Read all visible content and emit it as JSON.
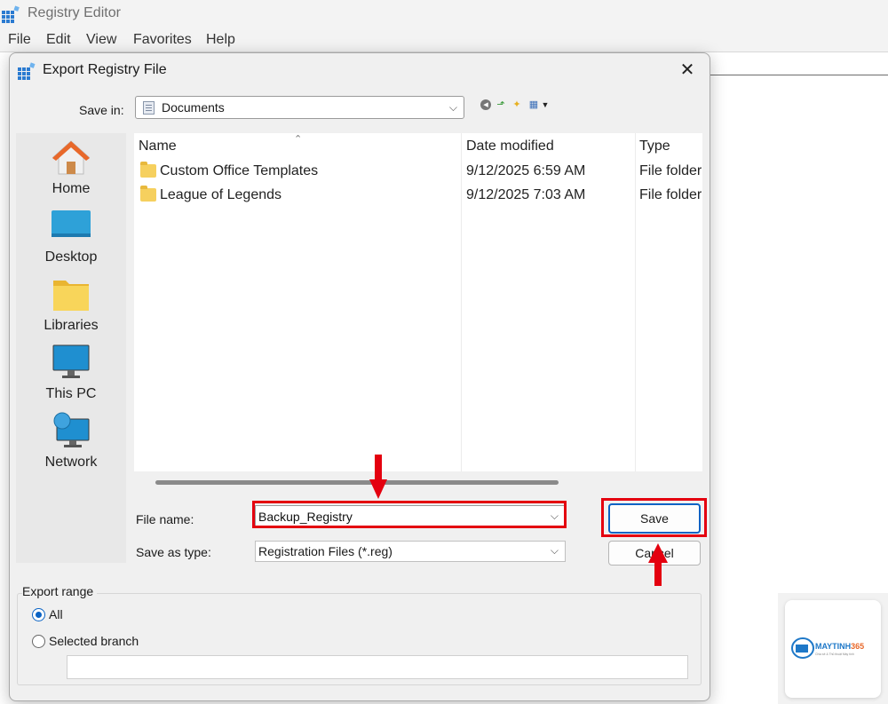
{
  "app": {
    "title": "Registry Editor",
    "menu": [
      "File",
      "Edit",
      "View",
      "Favorites",
      "Help"
    ]
  },
  "dialog": {
    "title": "Export Registry File",
    "close_label": "✕",
    "save_in_label": "Save in:",
    "save_in_value": "Documents",
    "places": [
      {
        "label": "Home",
        "icon": "home-icon"
      },
      {
        "label": "Desktop",
        "icon": "desktop-icon"
      },
      {
        "label": "Libraries",
        "icon": "libraries-icon"
      },
      {
        "label": "This PC",
        "icon": "this-pc-icon"
      },
      {
        "label": "Network",
        "icon": "network-icon"
      }
    ],
    "columns": [
      "Name",
      "Date modified",
      "Type"
    ],
    "files": [
      {
        "name": "Custom Office Templates",
        "date": "9/12/2025 6:59 AM",
        "type": "File folder"
      },
      {
        "name": "League of Legends",
        "date": "9/12/2025 7:03 AM",
        "type": "File folder"
      }
    ],
    "file_name_label": "File name:",
    "file_name_value": "Backup_Registry",
    "save_type_label": "Save as type:",
    "save_type_value": "Registration Files (*.reg)",
    "save_button": "Save",
    "cancel_button": "Cancel",
    "export_range": {
      "title": "Export range",
      "all_label": "All",
      "selected_label": "Selected branch",
      "branch_value": ""
    }
  },
  "watermark": {
    "brand": "MAYTINH365",
    "tagline": "Chia sẻ & Thủ thuật Máy tính"
  },
  "colors": {
    "highlight": "#e4000f",
    "accent": "#0b63c4",
    "folder": "#f6d05e"
  }
}
